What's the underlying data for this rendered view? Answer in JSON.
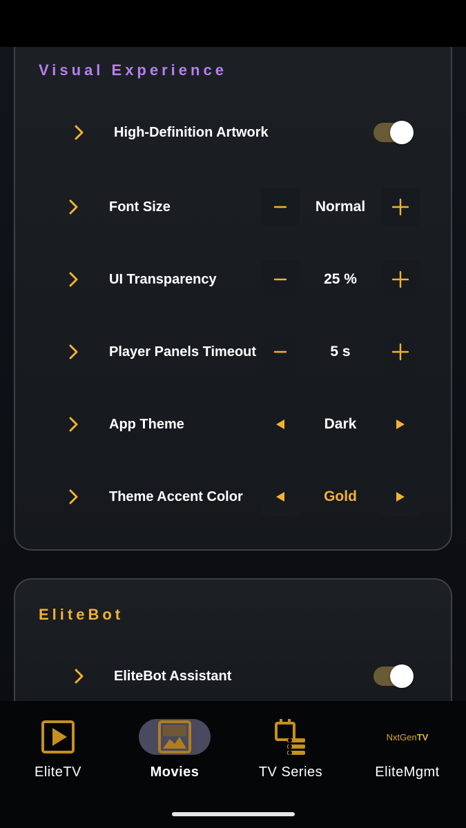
{
  "colors": {
    "accent_gold": "#f2b233",
    "accent_purple": "#b57ff2",
    "card_border": "#3c4147",
    "toggle_track_on": "#6a5a36"
  },
  "visual_section": {
    "title": "Visual Experience",
    "artwork": {
      "label": "High-Definition Artwork",
      "enabled": true
    },
    "font_size": {
      "label": "Font Size",
      "value": "Normal"
    },
    "transparency": {
      "label": "UI Transparency",
      "value": "25 %"
    },
    "panels_timeout": {
      "label": "Player Panels Timeout",
      "value": "5 s"
    },
    "app_theme": {
      "label": "App Theme",
      "value": "Dark"
    },
    "accent_color": {
      "label": "Theme Accent Color",
      "value": "Gold"
    }
  },
  "elitebot_section": {
    "title": "EliteBot",
    "assistant": {
      "label": "EliteBot Assistant",
      "enabled": true
    }
  },
  "icons": {
    "expand": "chevron-right-icon",
    "decrease": "minus-icon",
    "increase": "plus-icon",
    "previous": "triangle-left-icon",
    "next": "triangle-right-icon"
  },
  "bottom_nav": {
    "items": [
      {
        "label": "EliteTV",
        "icon": "play-box-icon",
        "active": false
      },
      {
        "label": "Movies",
        "icon": "image-icon",
        "active": true
      },
      {
        "label": "TV Series",
        "icon": "calendar-list-icon",
        "active": false
      },
      {
        "label": "EliteMgmt",
        "icon": "nxtgentv-logo",
        "active": false
      }
    ],
    "logo_text_a": "NxtGen",
    "logo_text_b": "TV"
  }
}
